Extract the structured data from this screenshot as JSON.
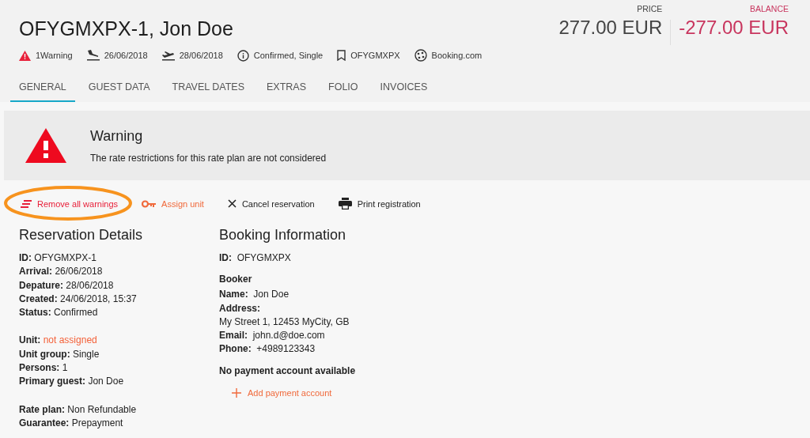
{
  "header": {
    "title": "OFYGMXPX-1, Jon Doe",
    "meta": [
      {
        "kind": "warning",
        "text": "1Warning"
      },
      {
        "kind": "arrival",
        "text": "26/06/2018"
      },
      {
        "kind": "departure",
        "text": "28/06/2018"
      },
      {
        "kind": "info",
        "text": "Confirmed, Single"
      },
      {
        "kind": "bookmark",
        "text": "OFYGMXPX"
      },
      {
        "kind": "channel",
        "text": "Booking.com"
      }
    ],
    "amounts": [
      {
        "kind": "price",
        "label": "PRICE",
        "value": "277.00 EUR"
      },
      {
        "kind": "balance",
        "label": "BALANCE",
        "value": "-277.00 EUR"
      }
    ]
  },
  "tabs": [
    {
      "label": "GENERAL",
      "selected": true
    },
    {
      "label": "GUEST DATA",
      "selected": false
    },
    {
      "label": "TRAVEL DATES",
      "selected": false
    },
    {
      "label": "EXTRAS",
      "selected": false
    },
    {
      "label": "FOLIO",
      "selected": false
    },
    {
      "label": "INVOICES",
      "selected": false
    }
  ],
  "warning": {
    "title": "Warning",
    "message": "The rate restrictions for this rate plan are not considered"
  },
  "actions": [
    {
      "kind": "remove",
      "label": "Remove all warnings",
      "circled": true
    },
    {
      "kind": "assign",
      "label": "Assign unit",
      "circled": false
    },
    {
      "kind": "cancel",
      "label": "Cancel reservation",
      "circled": false
    },
    {
      "kind": "print",
      "label": "Print registration",
      "circled": false
    }
  ],
  "reservation": {
    "title": "Reservation Details",
    "groups": [
      [
        {
          "label": "ID:",
          "value": "OFYGMXPX-1",
          "alert": false
        },
        {
          "label": "Arrival:",
          "value": "26/06/2018",
          "alert": false
        },
        {
          "label": "Depature:",
          "value": "28/06/2018",
          "alert": false
        },
        {
          "label": "Created:",
          "value": "24/06/2018, 15:37",
          "alert": false
        },
        {
          "label": "Status:",
          "value": "Confirmed",
          "alert": false
        }
      ],
      [
        {
          "label": "Unit:",
          "value": "not assigned",
          "alert": true
        },
        {
          "label": "Unit group:",
          "value": "Single",
          "alert": false
        },
        {
          "label": "Persons:",
          "value": "1",
          "alert": false
        },
        {
          "label": "Primary guest:",
          "value": "Jon Doe",
          "alert": false
        }
      ],
      [
        {
          "label": "Rate plan:",
          "value": "Non Refundable",
          "alert": false
        },
        {
          "label": "Guarantee:",
          "value": "Prepayment",
          "alert": false
        }
      ]
    ]
  },
  "booking": {
    "title": "Booking Information",
    "id_label": "ID:",
    "id_value": "OFYGMXPX",
    "booker_heading": "Booker",
    "booker": [
      {
        "label": "Name:",
        "value": "Jon Doe"
      },
      {
        "label": "Address:"
      }
    ],
    "address": "My Street 1, 12453 MyCity, GB",
    "contact": [
      {
        "label": "Email:",
        "value": "john.d@doe.com"
      },
      {
        "label": "Phone:",
        "value": "+4989123343"
      }
    ],
    "payment_note": "No payment account available",
    "add_payment": "Add payment account"
  }
}
